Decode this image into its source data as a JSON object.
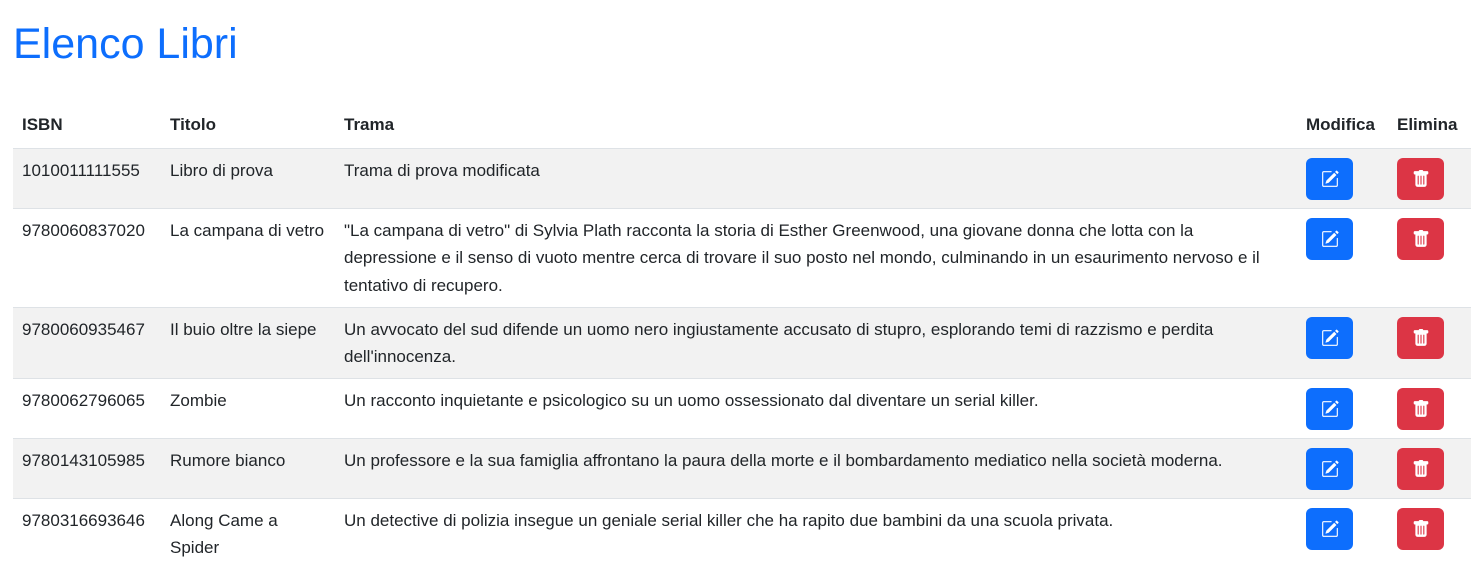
{
  "page": {
    "title": "Elenco Libri"
  },
  "table": {
    "headers": {
      "isbn": "ISBN",
      "titolo": "Titolo",
      "trama": "Trama",
      "modifica": "Modifica",
      "elimina": "Elimina"
    },
    "rows": [
      {
        "isbn": "1010011111555",
        "titolo": "Libro di prova",
        "trama": "Trama di prova modificata"
      },
      {
        "isbn": "9780060837020",
        "titolo": "La campana di vetro",
        "trama": "\"La campana di vetro\" di Sylvia Plath racconta la storia di Esther Greenwood, una giovane donna che lotta con la depressione e il senso di vuoto mentre cerca di trovare il suo posto nel mondo, culminando in un esaurimento nervoso e il tentativo di recupero."
      },
      {
        "isbn": "9780060935467",
        "titolo": "Il buio oltre la siepe",
        "trama": "Un avvocato del sud difende un uomo nero ingiustamente accusato di stupro, esplorando temi di razzismo e perdita dell'innocenza."
      },
      {
        "isbn": "9780062796065",
        "titolo": "Zombie",
        "trama": "Un racconto inquietante e psicologico su un uomo ossessionato dal diventare un serial killer."
      },
      {
        "isbn": "9780143105985",
        "titolo": "Rumore bianco",
        "trama": "Un professore e la sua famiglia affrontano la paura della morte e il bombardamento mediatico nella società moderna."
      },
      {
        "isbn": "9780316693646",
        "titolo": "Along Came a Spider",
        "trama": "Un detective di polizia insegue un geniale serial killer che ha rapito due bambini da una scuola privata."
      }
    ]
  },
  "icons": {
    "edit": "edit-icon",
    "delete": "trash-icon"
  },
  "colors": {
    "title": "#0d6efd",
    "edit_button": "#0d6efd",
    "delete_button": "#dc3545",
    "striped_row": "#f2f2f2"
  }
}
